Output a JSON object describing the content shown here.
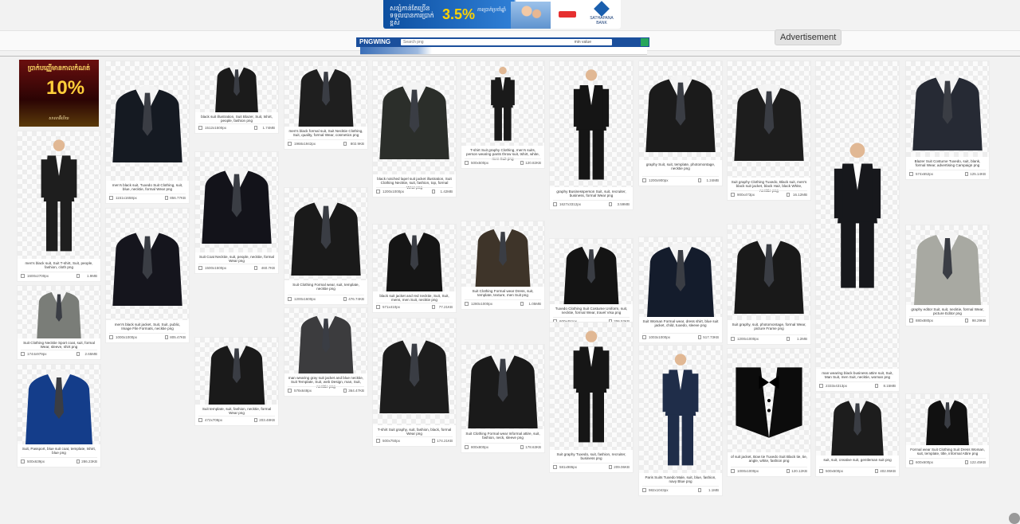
{
  "top_ad": {
    "headline": "សន្សំកាន់តែច្រើន ទទួលបានការប្រាក់ខ្ពស់",
    "rate": "3.5%",
    "detail": "ការប្រាក់ប្រចាំឆ្នាំ",
    "bank": "SATHAPANA BANK"
  },
  "advertisement_label": "Advertisement",
  "site": {
    "logo": "PNGWING",
    "search_placeholder": "Search png",
    "filter": "min value"
  },
  "side_ad": {
    "headline": "ប្រាក់បញ្ញើមានកាលកំណត់",
    "rate": "10%",
    "footer": "សាលាអ៊ីលីយ"
  },
  "cards": [
    {
      "caption": "men's black suit, Suit T-shirt, Suit, people, fashion, cloth png",
      "dims": "1600x2700px",
      "size": "1.9MB",
      "fill": "#1e1e1e",
      "shape": "full"
    },
    {
      "caption": "Suit Clothing Necktie Sport coat, suit, formal Wear, sleeve, shirt png",
      "dims": "1744x979px",
      "size": "2.65MB",
      "fill": "#7a7d78",
      "shape": "jacket"
    },
    {
      "caption": "Suit, Passport, blue suit coat, template, tshirt, blue png",
      "dims": "500x639px",
      "size": "286.23KB",
      "fill": "#143d8a",
      "shape": "jacket"
    },
    {
      "caption": "men's black suit, Tuxedo Suit Clothing, suit, blue, necktie, formal Wear png",
      "dims": "1151x1658px",
      "size": "856.77KB",
      "fill": "#151a22",
      "shape": "jacket"
    },
    {
      "caption": "men's black suit jacket, Suit, Suit, public, Image File Formats, necktie png",
      "dims": "1000x1000px",
      "size": "805.47KB",
      "fill": "#15151d",
      "shape": "jacket"
    },
    {
      "caption": "black suit illustration, Suit Blazer, Suit, tshirt, people, fashion png",
      "dims": "1512x1500px",
      "size": "1.74MB",
      "fill": "#1b1b1b",
      "shape": "jacket"
    },
    {
      "caption": "Suit Coat Necktie, suit, people, necktie, formal Wear png",
      "dims": "1500x1500px",
      "size": "460.7KB",
      "fill": "#13131a",
      "shape": "jacket"
    },
    {
      "caption": "Suit template, suit, fashion, necktie, formal Wear png",
      "dims": "472x708px",
      "size": "203.48KB",
      "fill": "#1a1a1a",
      "shape": "jacket"
    },
    {
      "caption": "men's black formal suit, Suit Necktie Clothing, Suit, quality, formal Wear, cosmetics png",
      "dims": "1968x1942px",
      "size": "802.9KB",
      "fill": "#1f1f1f",
      "shape": "jacket"
    },
    {
      "caption": "Suit Clothing Formal wear, suit, template, necktie png",
      "dims": "1200x1600px",
      "size": "476.74KB",
      "fill": "#1a1a1a",
      "shape": "jacket"
    },
    {
      "caption": "man wearing gray suit jacket and blue necktie, Suit Template, Suit, web Design, man, Suit, necktie png",
      "dims": "578x648px",
      "size": "364.47KB",
      "fill": "#3c3c3e",
      "shape": "jacket"
    },
    {
      "caption": "black notched lapel suit jacket illustration, Suit Clothing Necktie, suit, fashion, top, formal Wear png",
      "dims": "1200x1000px",
      "size": "1.42MB",
      "fill": "#2b2e2a",
      "shape": "jacket"
    },
    {
      "caption": "black suit jacket and red necktie, Suit, Suit, mens, men Suit, necktie png",
      "dims": "571x410px",
      "size": "77.21KB",
      "fill": "#151515",
      "shape": "jacket"
    },
    {
      "caption": "T-shirt Suit graphy, suit, fashion, black, formal Wear png",
      "dims": "500x750px",
      "size": "174.21KB",
      "fill": "#1d1d1d",
      "shape": "jacket"
    },
    {
      "caption": "T-shirt Suit graphy Clothing, men's suits, person wearing pants throw suit, tshirt, white, men Suit png",
      "dims": "500x500px",
      "size": "120.82KB",
      "fill": "#1a1a1a",
      "shape": "full"
    },
    {
      "caption": "Suit Clothing Formal wear Dress, suit, template, texture, men Suit png",
      "dims": "1280x1000px",
      "size": "1.05MB",
      "fill": "#3e3429",
      "shape": "jacket"
    },
    {
      "caption": "Suit Clothing Formal wear Informal attire, suit, fashion, neck, sleeve png",
      "dims": "800x800px",
      "size": "178.63KB",
      "fill": "#1a1a1a",
      "shape": "jacket"
    },
    {
      "caption": "graphy Businessperson Suit, suit, recruiter, business, formal Wear png",
      "dims": "1627x3312px",
      "size": "3.59MB",
      "fill": "#151515",
      "shape": "full"
    },
    {
      "caption": "Tuxedo Clothing Suit Costume Uniform, suit, necktie, formal Wear, travel Visa png",
      "dims": "600x451px",
      "size": "206.52KB",
      "fill": "#141414",
      "shape": "jacket"
    },
    {
      "caption": "Suit graphy Tuxedo, suit, fashion, recruiter, business png",
      "dims": "581x986px",
      "size": "209.06KB",
      "fill": "#161616",
      "shape": "full"
    },
    {
      "caption": "graphy Suit, suit, template, photomontage, necktie png",
      "dims": "1200x900px",
      "size": "1.24MB",
      "fill": "#1b1b1b",
      "shape": "jacket"
    },
    {
      "caption": "Suit Woman Formal wear, dress shirt, blue suit jacket, child, tuxedo, sleeve png",
      "dims": "1003x1000px",
      "size": "517.73KB",
      "fill": "#141c2c",
      "shape": "jacket"
    },
    {
      "caption": "Paris Suits Tuxedo Male, suit, blue, fashion, navy Blue png",
      "dims": "982x1043px",
      "size": "1.1MB",
      "fill": "#1f2d49",
      "shape": "full"
    },
    {
      "caption": "Suit graphy Clothing Tuxedo, Black suit, men's black suit jacket, black Hair, black White, necktie png",
      "dims": "900x473px",
      "size": "16.12MB",
      "fill": "#1d1d1d",
      "shape": "jacket"
    },
    {
      "caption": "Suit graphy, suit, photomontage, formal Wear, picture Frame png",
      "dims": "1200x1000px",
      "size": "1.2MB",
      "fill": "#191919",
      "shape": "jacket"
    },
    {
      "caption": "of suit jacket, Bow tie Tuxedo Suit Black tie, tie, angle, white, fashion png",
      "dims": "1000x1000px",
      "size": "120.12KB",
      "fill": "#0c0c0c",
      "shape": "tux"
    },
    {
      "caption": "man wearing black business attire suit, Suit, Man Suit, men Suit, necktie, woman png",
      "dims": "2333x4313px",
      "size": "8.15MB",
      "fill": "#17181c",
      "shape": "full"
    },
    {
      "caption": "suit, suit, creative suit, gentleman suit png",
      "dims": "500x500px",
      "size": "402.95KB",
      "fill": "#1d1d1d",
      "shape": "jacket"
    },
    {
      "caption": "Blazer Suit Costume Tuxedo, suit, blank, formal Wear, advertising Campaign png",
      "dims": "574x652px",
      "size": "125.14KB",
      "fill": "#262a34",
      "shape": "jacket"
    },
    {
      "caption": "graphy editor Suit, suit, necktie, formal Wear, picture Editor png",
      "dims": "880x880px",
      "size": "98.29KB",
      "fill": "#a8a9a2",
      "shape": "jacket"
    },
    {
      "caption": "Formal wear Suit Clothing Suit Dress Woman, suit, template, title, informal Attire png",
      "dims": "600x600px",
      "size": "122.45KB",
      "fill": "#111",
      "shape": "jacket"
    }
  ]
}
